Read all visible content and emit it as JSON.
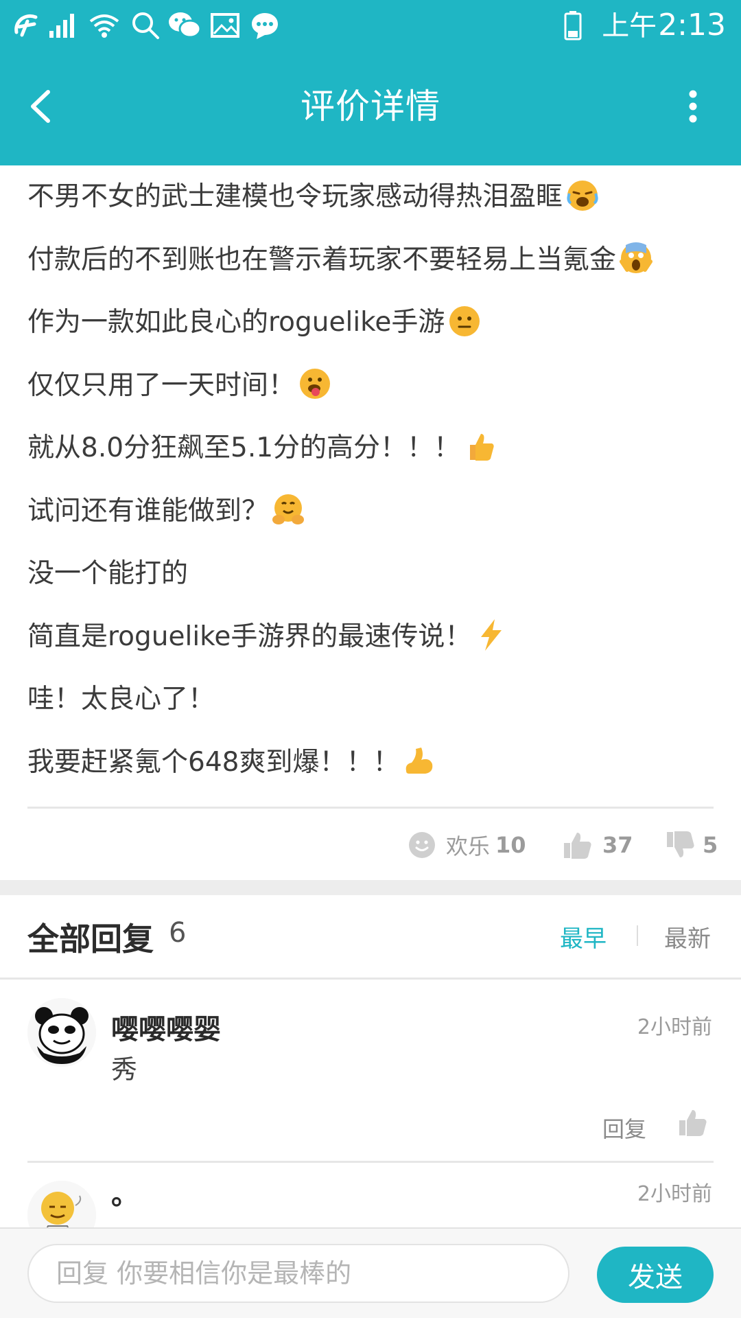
{
  "status_bar": {
    "ampm": "上午",
    "time": "2:13",
    "icons": [
      "carrier-logo-icon",
      "signal-icon",
      "wifi-icon",
      "search-icon",
      "wechat-icon",
      "image-icon",
      "message-icon",
      "battery-icon"
    ]
  },
  "header": {
    "title": "评价详情",
    "back_icon": "chevron-left-icon",
    "more_icon": "more-vertical-icon"
  },
  "review": {
    "lines": [
      {
        "text": "不男不女的武士建模也令玩家感动得热泪盈眶",
        "emoji": "crying-face"
      },
      {
        "text": "付款后的不到账也在警示着玩家不要轻易上当氪金",
        "emoji": "screaming-face"
      },
      {
        "text": "作为一款如此良心的roguelike手游",
        "emoji": "neutral-face"
      },
      {
        "text": "仅仅只用了一天时间！",
        "emoji": "tongue-face"
      },
      {
        "text": "就从8.0分狂飙至5.1分的高分！！！",
        "emoji": "thumbs-up"
      },
      {
        "text": "试问还有谁能做到？",
        "emoji": "hugging-face"
      },
      {
        "text": "没一个能打的",
        "emoji": ""
      },
      {
        "text": "简直是roguelike手游界的最速传说！",
        "emoji": "lightning"
      },
      {
        "text": "哇！太良心了！",
        "emoji": ""
      },
      {
        "text": "我要赶紧氪个648爽到爆！！！",
        "emoji": "flexed-biceps"
      }
    ],
    "reactions": {
      "happy_label": "欢乐",
      "happy_count": "10",
      "like_count": "37",
      "dislike_count": "5"
    }
  },
  "replies": {
    "title": "全部回复",
    "count": "6",
    "sort_earliest": "最早",
    "sort_latest": "最新",
    "items": [
      {
        "name": "嘤嘤嘤婴",
        "time": "2小时前",
        "text": "秀",
        "reply_label": "回复"
      },
      {
        "name": "。",
        "time": "2小时前",
        "text": "",
        "reply_label": ""
      }
    ]
  },
  "input_bar": {
    "placeholder": "回复 你要相信你是最棒的",
    "send_label": "发送"
  },
  "colors": {
    "accent": "#1fb6c4",
    "text": "#3b3b3b",
    "muted": "#9b9b9b"
  }
}
